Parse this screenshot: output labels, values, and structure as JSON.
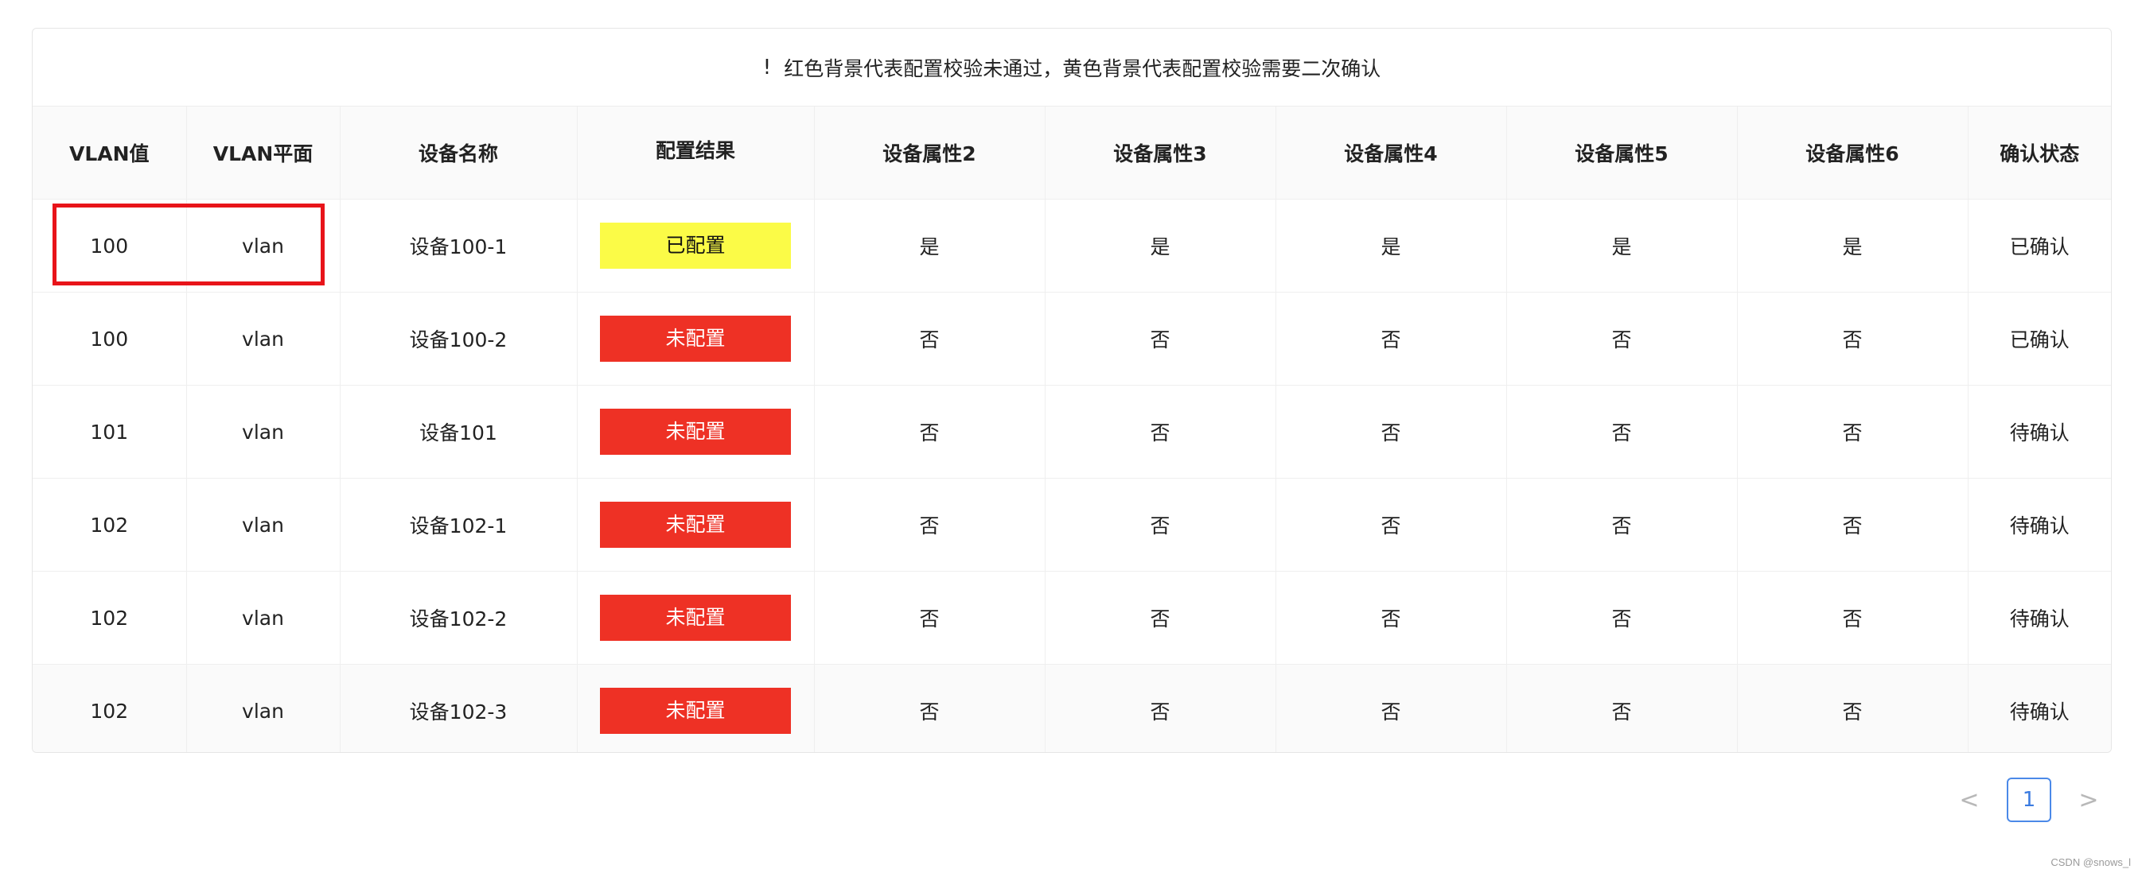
{
  "notice": {
    "icon": "!",
    "text": "红色背景代表配置校验未通过，黄色背景代表配置校验需要二次确认"
  },
  "columns": [
    "VLAN值",
    "VLAN平面",
    "设备名称",
    "配置结果",
    "设备属性2",
    "设备属性3",
    "设备属性4",
    "设备属性5",
    "设备属性6",
    "确认状态"
  ],
  "rows": [
    {
      "vlan": "100",
      "plane": "vlan",
      "device": "设备100-1",
      "result": "已配置",
      "status_color": "yellow",
      "attrs": [
        "是",
        "是",
        "是",
        "是",
        "是"
      ],
      "confirm": "已确认"
    },
    {
      "vlan": "100",
      "plane": "vlan",
      "device": "设备100-2",
      "result": "未配置",
      "status_color": "red",
      "attrs": [
        "否",
        "否",
        "否",
        "否",
        "否"
      ],
      "confirm": "已确认"
    },
    {
      "vlan": "101",
      "plane": "vlan",
      "device": "设备101",
      "result": "未配置",
      "status_color": "red",
      "attrs": [
        "否",
        "否",
        "否",
        "否",
        "否"
      ],
      "confirm": "待确认"
    },
    {
      "vlan": "102",
      "plane": "vlan",
      "device": "设备102-1",
      "result": "未配置",
      "status_color": "red",
      "attrs": [
        "否",
        "否",
        "否",
        "否",
        "否"
      ],
      "confirm": "待确认"
    },
    {
      "vlan": "102",
      "plane": "vlan",
      "device": "设备102-2",
      "result": "未配置",
      "status_color": "red",
      "attrs": [
        "否",
        "否",
        "否",
        "否",
        "否"
      ],
      "confirm": "待确认"
    },
    {
      "vlan": "102",
      "plane": "vlan",
      "device": "设备102-3",
      "result": "未配置",
      "status_color": "red",
      "attrs": [
        "否",
        "否",
        "否",
        "否",
        "否"
      ],
      "confirm": "待确认"
    }
  ],
  "colors": {
    "yellow_tag": "#fbfb47",
    "red_tag": "#ee3125",
    "highlight_border": "#e8141a",
    "page_accent": "#4b89e8"
  },
  "pagination": {
    "prev": "<",
    "current": "1",
    "next": ">"
  },
  "watermark": "CSDN @snows_l"
}
